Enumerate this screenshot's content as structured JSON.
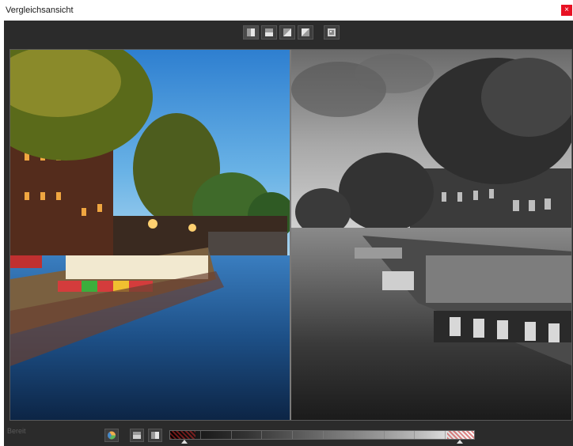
{
  "window": {
    "title": "Vergleichsansicht",
    "close_glyph": "×"
  },
  "toolbar": {
    "buttons": [
      {
        "icon": "split-vertical-icon",
        "active": true
      },
      {
        "icon": "split-horizontal-icon",
        "active": false
      },
      {
        "icon": "split-diagonal-left-icon",
        "active": false
      },
      {
        "icon": "split-diagonal-right-icon",
        "active": false
      },
      {
        "icon": "single-view-icon",
        "active": false
      }
    ]
  },
  "viewer": {
    "left_image": "canal-color",
    "right_image": "canal-grayscale",
    "split_position_percent": 50
  },
  "statusbar": {
    "status_text": "Bereit"
  },
  "bottom_toolbar": {
    "buttons": [
      {
        "icon": "color-wheel-icon"
      },
      {
        "icon": "histogram-icon"
      },
      {
        "icon": "compare-toggle-icon"
      }
    ]
  },
  "tone_range": {
    "black_point_percent": 5,
    "white_point_percent": 95
  },
  "colors": {
    "clip_warning": "#c82828",
    "accent_close": "#e81123"
  }
}
